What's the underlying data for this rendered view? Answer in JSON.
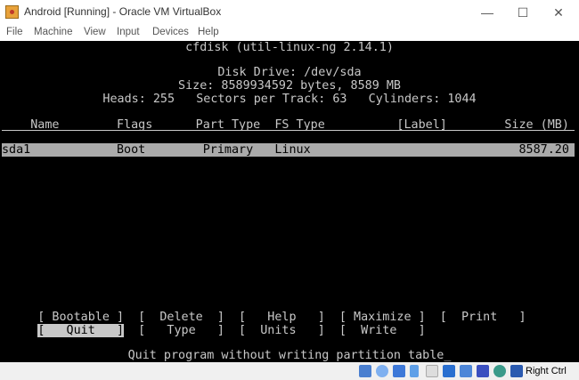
{
  "window": {
    "title": "Android [Running] - Oracle VM VirtualBox",
    "minimize": "—",
    "maximize": "☐",
    "close": "✕"
  },
  "menu": [
    "File",
    "Machine",
    "View",
    "Input",
    "Devices",
    "Help"
  ],
  "terminal": {
    "title": "cfdisk (util-linux-ng 2.14.1)",
    "disk_drive": "Disk Drive: /dev/sda",
    "size": "Size: 8589934592 bytes, 8589 MB",
    "geometry": "Heads: 255   Sectors per Track: 63   Cylinders: 1044",
    "table_header": "    Name        Flags      Part Type  FS Type          [Label]        Size (MB)",
    "rows": [
      "sda1            Boot        Primary   Linux                             8587.20 "
    ],
    "menu_row1": "     [ Bootable ]  [  Delete  ]  [   Help   ]  [ Maximize ]  [  Print   ]",
    "menu_row2_prefix": "     ",
    "menu_quit": "[   Quit   ]",
    "menu_row2_rest": "  [   Type   ]  [  Units   ]  [  Write   ]",
    "status": "Quit program without writing partition table_"
  },
  "statusbar": {
    "host_key": "Right Ctrl",
    "icons": [
      "hard-disk-icon",
      "optical-drive-icon",
      "network-icon",
      "usb-icon",
      "shared-folders-icon",
      "display-icon",
      "video-capture-icon",
      "recording-icon",
      "mouse-integration-icon",
      "keyboard-capture-icon"
    ]
  }
}
